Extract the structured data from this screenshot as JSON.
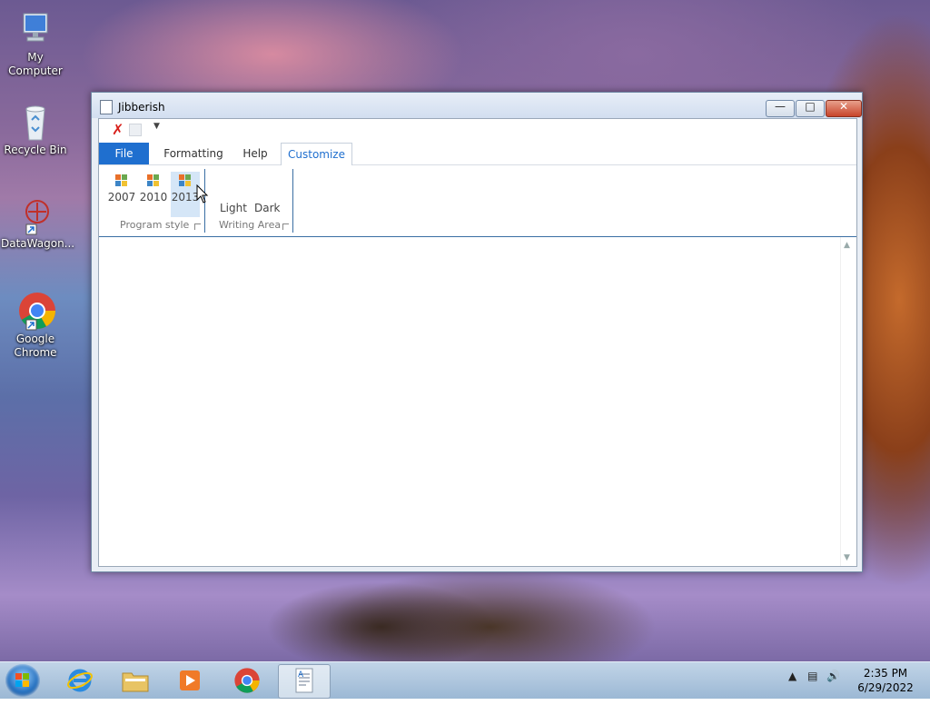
{
  "desktop": {
    "icons": [
      {
        "label": "My Computer"
      },
      {
        "label": "Recycle Bin"
      },
      {
        "label": "DataWagon..."
      },
      {
        "label": "Google Chrome"
      }
    ]
  },
  "window": {
    "title": "Jibberish",
    "tabs": [
      "File",
      "Formatting",
      "Help",
      "Customize"
    ],
    "active_tab": "Customize",
    "ribbon": {
      "program_style": {
        "label": "Program style",
        "buttons": [
          "2007",
          "2010",
          "2013"
        ],
        "selected": "2013"
      },
      "writing_area": {
        "label": "Writing Area",
        "buttons": [
          "Light",
          "Dark"
        ]
      }
    }
  },
  "taskbar": {
    "time": "2:35 PM",
    "date": "6/29/2022"
  },
  "colors": {
    "accent": "#1f6fcf",
    "close_button": "#c7442a"
  }
}
